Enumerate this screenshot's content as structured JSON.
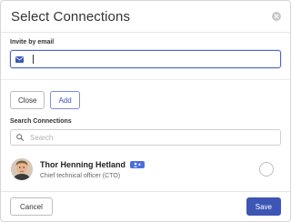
{
  "dialog": {
    "title": "Select Connections"
  },
  "invite": {
    "label": "Invite by email",
    "value": ""
  },
  "actions": {
    "close_label": "Close",
    "add_label": "Add"
  },
  "search": {
    "label": "Search Connections",
    "placeholder": "Search"
  },
  "connections": [
    {
      "name": "Thor Henning Hetland",
      "title": "Chief technical officer (CTO)",
      "selected": false
    }
  ],
  "footer": {
    "cancel_label": "Cancel",
    "save_label": "Save"
  },
  "colors": {
    "accent": "#3d56b5",
    "badge": "#4a6fd8"
  },
  "icons": {
    "close": "close-circle-icon",
    "email": "envelope-icon",
    "search": "search-icon",
    "badge": "user-plus-icon"
  }
}
